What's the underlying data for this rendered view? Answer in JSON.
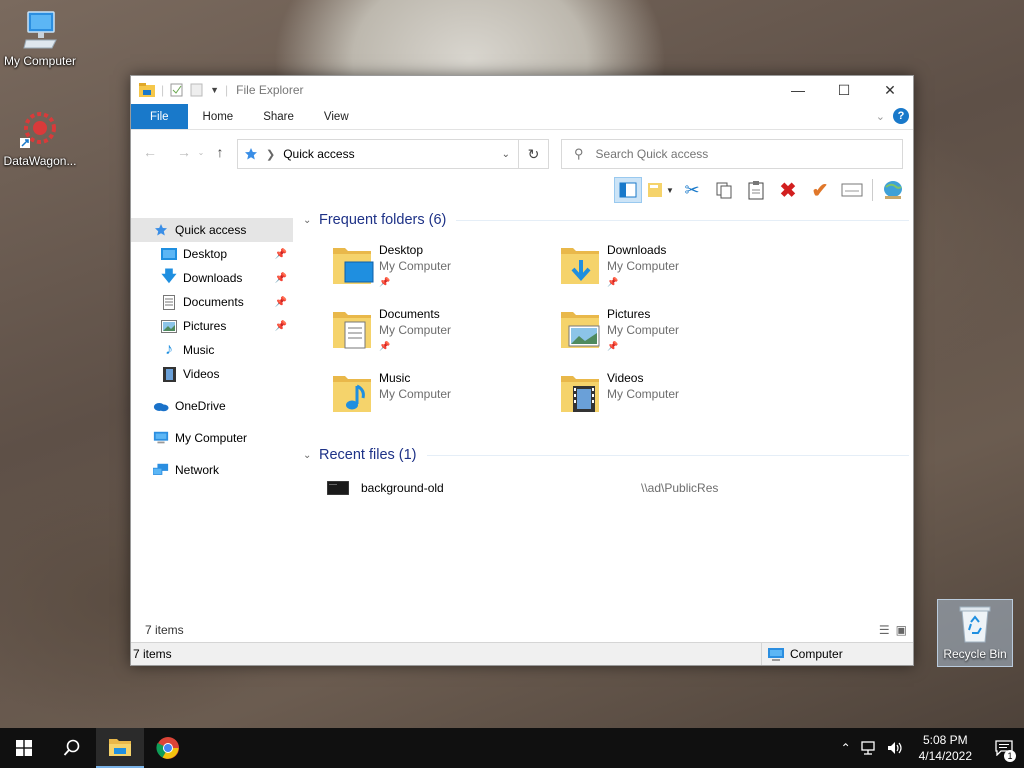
{
  "desktop": {
    "icons": [
      {
        "label": "My Computer",
        "icon": "computer-icon"
      },
      {
        "label": "DataWagon...",
        "icon": "datawagon-icon"
      }
    ],
    "recycle_bin": {
      "label": "Recycle Bin",
      "icon": "recycle-bin-icon"
    }
  },
  "window": {
    "title": "File Explorer",
    "ribbon_tabs": [
      "File",
      "Home",
      "Share",
      "View"
    ],
    "address": {
      "location": "Quick access"
    },
    "search": {
      "placeholder": "Search Quick access"
    },
    "nav": {
      "quick_access": "Quick access",
      "items": [
        {
          "label": "Desktop",
          "pinned": true,
          "icon": "desktop-icon"
        },
        {
          "label": "Downloads",
          "pinned": true,
          "icon": "downloads-icon"
        },
        {
          "label": "Documents",
          "pinned": true,
          "icon": "documents-icon"
        },
        {
          "label": "Pictures",
          "pinned": true,
          "icon": "pictures-icon"
        },
        {
          "label": "Music",
          "pinned": false,
          "icon": "music-icon"
        },
        {
          "label": "Videos",
          "pinned": false,
          "icon": "videos-icon"
        }
      ],
      "onedrive": "OneDrive",
      "my_computer": "My Computer",
      "network": "Network"
    },
    "frequent": {
      "header": "Frequent folders (6)",
      "folders": [
        {
          "name": "Desktop",
          "location": "My Computer",
          "pinned": true
        },
        {
          "name": "Downloads",
          "location": "My Computer",
          "pinned": true
        },
        {
          "name": "Documents",
          "location": "My Computer",
          "pinned": true
        },
        {
          "name": "Pictures",
          "location": "My Computer",
          "pinned": true
        },
        {
          "name": "Music",
          "location": "My Computer",
          "pinned": false
        },
        {
          "name": "Videos",
          "location": "My Computer",
          "pinned": false
        }
      ]
    },
    "recent": {
      "header": "Recent files (1)",
      "files": [
        {
          "name": "background-old",
          "path": "\\\\ad\\PublicRes"
        }
      ]
    },
    "status_inner": "7 items",
    "status_outer": {
      "count": "7 items",
      "zone": "Computer"
    }
  },
  "taskbar": {
    "time": "5:08 PM",
    "date": "4/14/2022",
    "notification_count": "1"
  },
  "colors": {
    "accent": "#1979ca",
    "group_header": "#1e3287",
    "folder": "#f5d36b"
  }
}
